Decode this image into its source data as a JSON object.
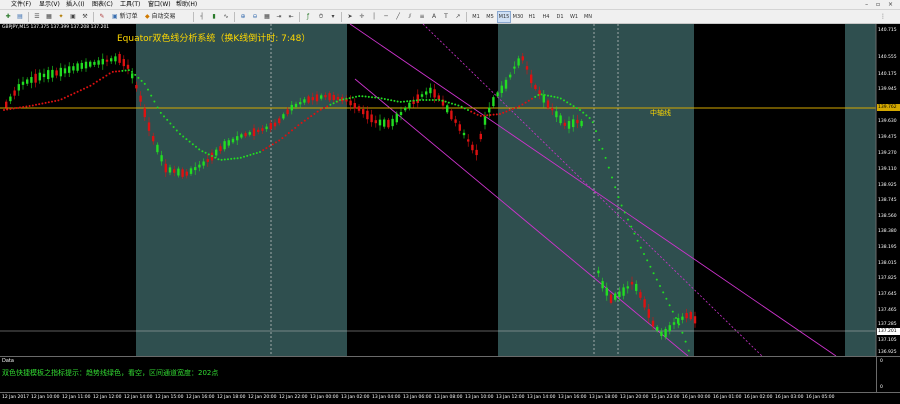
{
  "menu": [
    "文件(F)",
    "显示(V)",
    "插入(I)",
    "图表(C)",
    "工具(T)",
    "窗口(W)",
    "帮助(H)"
  ],
  "toolbar": {
    "new_order": "新订单",
    "auto_trade": "自动交易",
    "timeframes": [
      "M1",
      "M5",
      "M15",
      "M30",
      "H1",
      "H4",
      "D1",
      "W1",
      "MN"
    ],
    "active_timeframe": "M15"
  },
  "chart": {
    "symbol_info": "GBPJPY,M15  137.375 137.399 137.208 137.201",
    "title": "Equator双色线分析系统（换K线倒计时: 7:48）",
    "mid_line_label": "中轴线",
    "price_ticks": [
      "140.715",
      "140.555",
      "140.175",
      "139.945",
      "139.630",
      "139.475",
      "139.270",
      "139.110",
      "138.925",
      "138.745",
      "138.560",
      "138.380",
      "138.195",
      "138.015",
      "137.825",
      "137.645",
      "137.465",
      "137.285",
      "137.105",
      "136.925"
    ],
    "mid_price": "139.762",
    "current_price": "137.201",
    "colors": {
      "background": "#000000",
      "session": "#2f4f4f",
      "bull": "#22dd22",
      "bear": "#dd1111",
      "channel": "#cc33cc",
      "midline": "#d4a800"
    }
  },
  "indicator": {
    "header": "Data",
    "text": "双色快捷模板之指标提示：趋势线绿色，看空，区间通道宽度：202点",
    "axis_values": [
      "0",
      "0"
    ]
  },
  "time_axis": [
    "12 Jan 2017",
    "12 Jan 10:00",
    "12 Jan 11:00",
    "12 Jan 12:00",
    "12 Jan 14:00",
    "12 Jan 15:00",
    "12 Jan 16:00",
    "12 Jan 18:00",
    "12 Jan 20:00",
    "12 Jan 22:00",
    "13 Jan 00:00",
    "13 Jan 02:00",
    "13 Jan 04:00",
    "13 Jan 06:00",
    "13 Jan 08:00",
    "13 Jan 10:00",
    "13 Jan 12:00",
    "13 Jan 14:00",
    "13 Jan 16:00",
    "13 Jan 18:00",
    "13 Jan 20:00",
    "15 Jan 23:00",
    "16 Jan 00:00",
    "16 Jan 01:00",
    "16 Jan 02:00",
    "16 Jan 03:00",
    "16 Jan 05:00"
  ]
}
